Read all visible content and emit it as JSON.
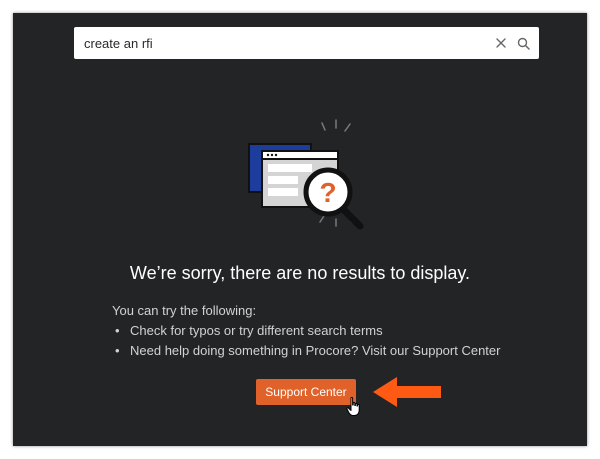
{
  "search": {
    "value": "create an rfi",
    "clear_icon": "close-icon",
    "search_icon": "magnifier-icon"
  },
  "empty_state": {
    "illustration": "browser-window-question-magnifier",
    "headline": "We’re sorry, there are no results to display.",
    "intro": "You can try the following:",
    "suggestions": [
      "Check for typos or try different search terms",
      "Need help doing something in Procore? Visit our Support Center"
    ],
    "button_label": "Support Center"
  },
  "annotation": {
    "arrow_color": "#ff5a14"
  },
  "colors": {
    "background": "#232426",
    "accent": "#e0622a",
    "illustration_blue": "#1c3d9c"
  }
}
